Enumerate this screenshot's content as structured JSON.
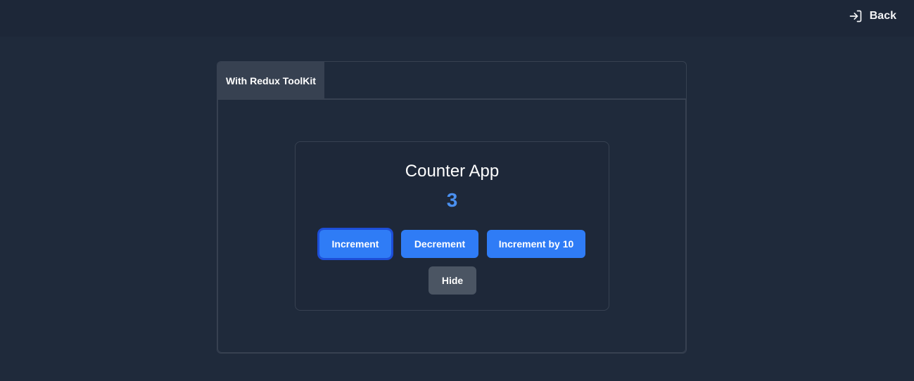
{
  "header": {
    "back_label": "Back",
    "back_icon": "sign-in-arrow-icon"
  },
  "tabs": [
    {
      "label": "With Redux ToolKit",
      "active": true
    }
  ],
  "counter_card": {
    "title": "Counter App",
    "value": "3",
    "buttons": {
      "increment": "Increment",
      "decrement": "Decrement",
      "increment_by_10": "Increment by 10",
      "hide": "Hide"
    }
  },
  "colors": {
    "background": "#1f2a3b",
    "accent": "#2f7cf6",
    "value_text": "#4a90f0",
    "secondary_button": "#4b5563",
    "border": "#374151"
  }
}
